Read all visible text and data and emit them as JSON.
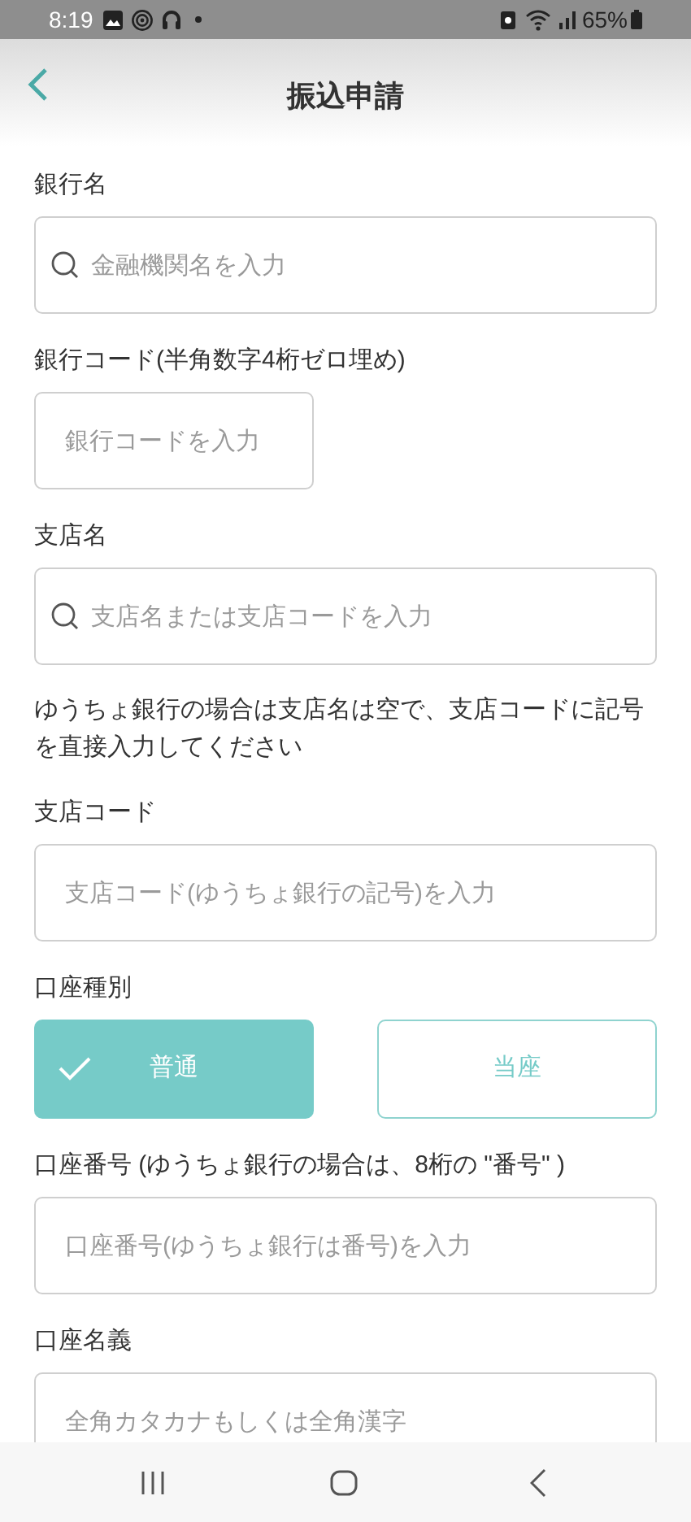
{
  "status_bar": {
    "time": "8:19",
    "battery": "65%"
  },
  "header": {
    "title": "振込申請"
  },
  "form": [
    {
      "kind": "label",
      "text": "銀行名"
    },
    {
      "kind": "field",
      "placeholder": "金融機関名を入力",
      "search": true,
      "wide": true
    },
    {
      "kind": "label",
      "text": "銀行コード(半角数字4桁ゼロ埋め)"
    },
    {
      "kind": "field",
      "placeholder": "銀行コードを入力",
      "search": false,
      "wide": false
    },
    {
      "kind": "label",
      "text": "支店名"
    },
    {
      "kind": "field",
      "placeholder": "支店名または支店コードを入力",
      "search": true,
      "wide": true
    },
    {
      "kind": "note",
      "text": "ゆうちょ銀行の場合は支店名は空で、支店コードに記号を直接入力してください"
    },
    {
      "kind": "label",
      "text": "支店コード"
    },
    {
      "kind": "field",
      "placeholder": "支店コード(ゆうちょ銀行の記号)を入力",
      "search": false,
      "wide": true
    },
    {
      "kind": "label",
      "text": "口座種別"
    },
    {
      "kind": "choice",
      "options": [
        {
          "label": "普通",
          "selected": true
        },
        {
          "label": "当座",
          "selected": false
        }
      ]
    },
    {
      "kind": "label",
      "text": "口座番号 (ゆうちょ銀行の場合は、8桁の \"番号\" )"
    },
    {
      "kind": "field",
      "placeholder": "口座番号(ゆうちょ銀行は番号)を入力",
      "search": false,
      "wide": true
    },
    {
      "kind": "label",
      "text": "口座名義"
    },
    {
      "kind": "field",
      "placeholder": "全角カタカナもしくは全角漢字",
      "search": false,
      "wide": true
    }
  ]
}
